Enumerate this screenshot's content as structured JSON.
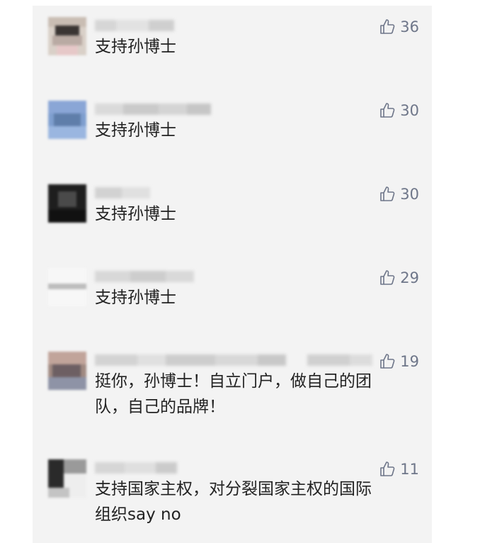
{
  "comments": [
    {
      "text": "支持孙博士",
      "likes": "36"
    },
    {
      "text": "支持孙博士",
      "likes": "30"
    },
    {
      "text": "支持孙博士",
      "likes": "30"
    },
    {
      "text": "支持孙博士",
      "likes": "29"
    },
    {
      "text": "挺你，孙博士！自立门户，做自己的团\n队，自己的品牌！",
      "likes": "19"
    },
    {
      "text": "支持国家主权，对分裂国家主权的国际\n组织say no",
      "likes": "11"
    }
  ],
  "icons": {
    "like": "thumbs-up-icon"
  },
  "colors": {
    "panel": "#f3f3f3",
    "text": "#222222",
    "like": "#6e7689"
  }
}
